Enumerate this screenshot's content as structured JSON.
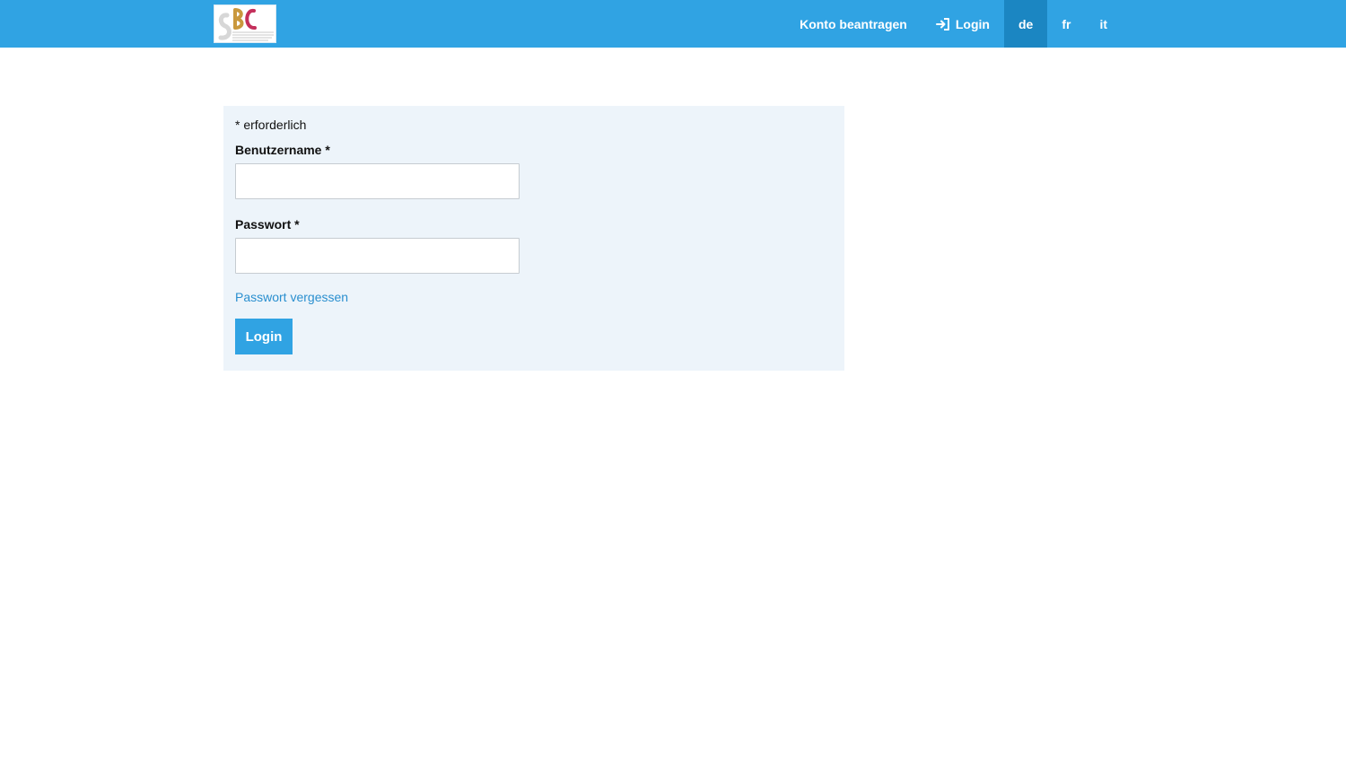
{
  "brand": {
    "logo_icon": "sbc-logo",
    "accent_color": "#30a3e3",
    "logo_text": "SBC"
  },
  "nav": {
    "request_account": "Konto beantragen",
    "login_icon": "sign-in-icon",
    "login": "Login",
    "languages": [
      {
        "code": "de",
        "active": true
      },
      {
        "code": "fr",
        "active": false
      },
      {
        "code": "it",
        "active": false
      }
    ]
  },
  "form": {
    "required_note": "* erforderlich",
    "username_label": "Benutzername *",
    "username_value": "",
    "password_label": "Passwort *",
    "password_value": "",
    "forgot_password": "Passwort vergessen",
    "submit": "Login"
  }
}
